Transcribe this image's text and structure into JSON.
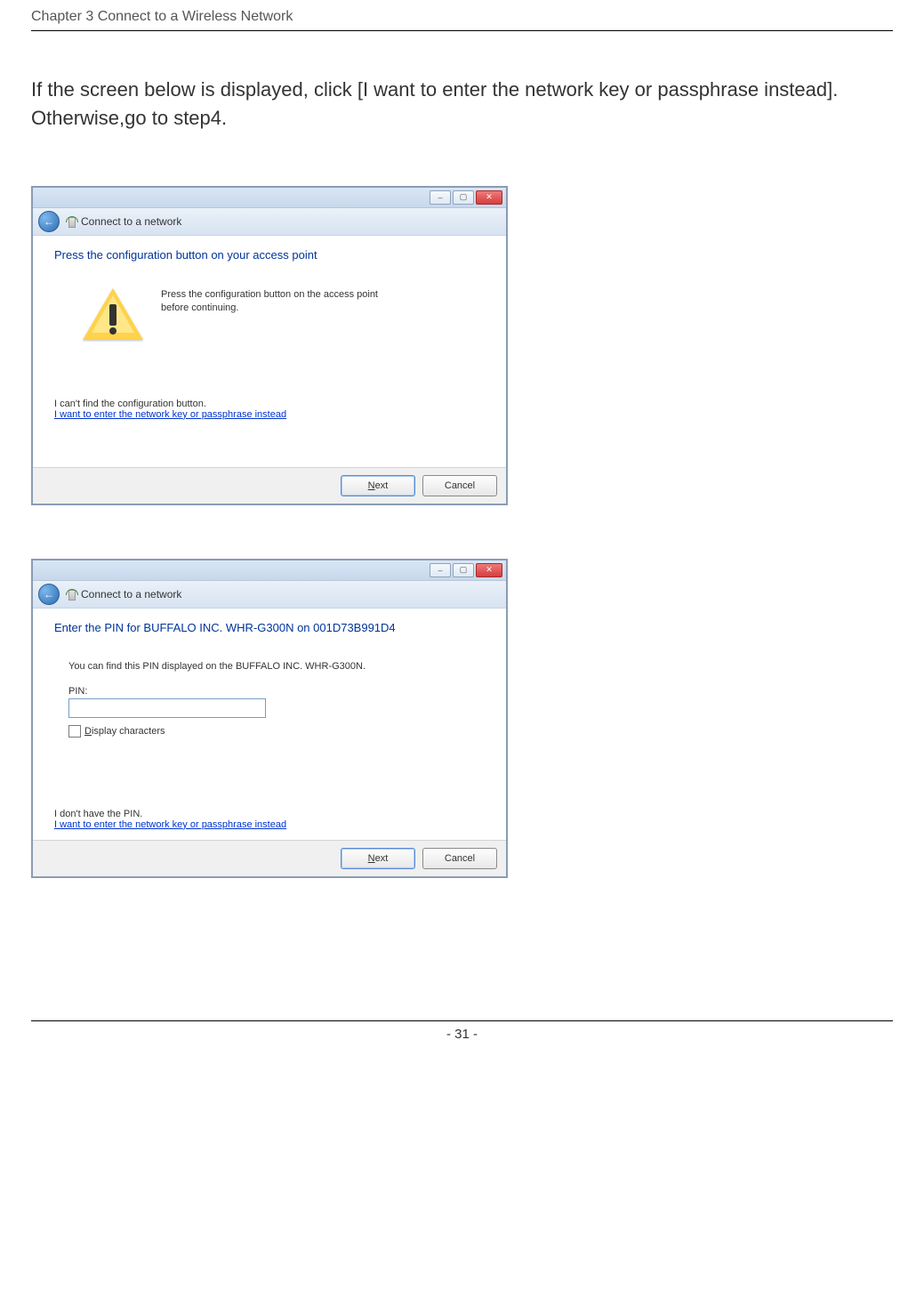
{
  "chapter_header": "Chapter 3  Connect to a Wireless Network",
  "intro_line1": "If the screen below is displayed, click [I want to enter the network key or passphrase instead].",
  "intro_line2": "Otherwise,go to step4.",
  "footer": "- 31 -",
  "dialog1": {
    "nav_title": "Connect to a network",
    "heading": "Press the configuration button on your access point",
    "warn_text": "Press the configuration button on the access point before continuing.",
    "cant_find": "I can't find the configuration button.",
    "link": "I want to enter the network key or passphrase instead",
    "next_u": "N",
    "next_rest": "ext",
    "cancel": "Cancel"
  },
  "dialog2": {
    "nav_title": "Connect to a network",
    "heading": "Enter the PIN for BUFFALO INC. WHR-G300N on 001D73B991D4",
    "find_pin": "You can find this PIN displayed on the BUFFALO INC. WHR-G300N.",
    "pin_label": "PIN:",
    "display_u": "D",
    "display_rest": "isplay characters",
    "no_pin": "I don't have the PIN.",
    "link": "I want to enter the network key or passphrase instead",
    "next_u": "N",
    "next_rest": "ext",
    "cancel": "Cancel"
  }
}
